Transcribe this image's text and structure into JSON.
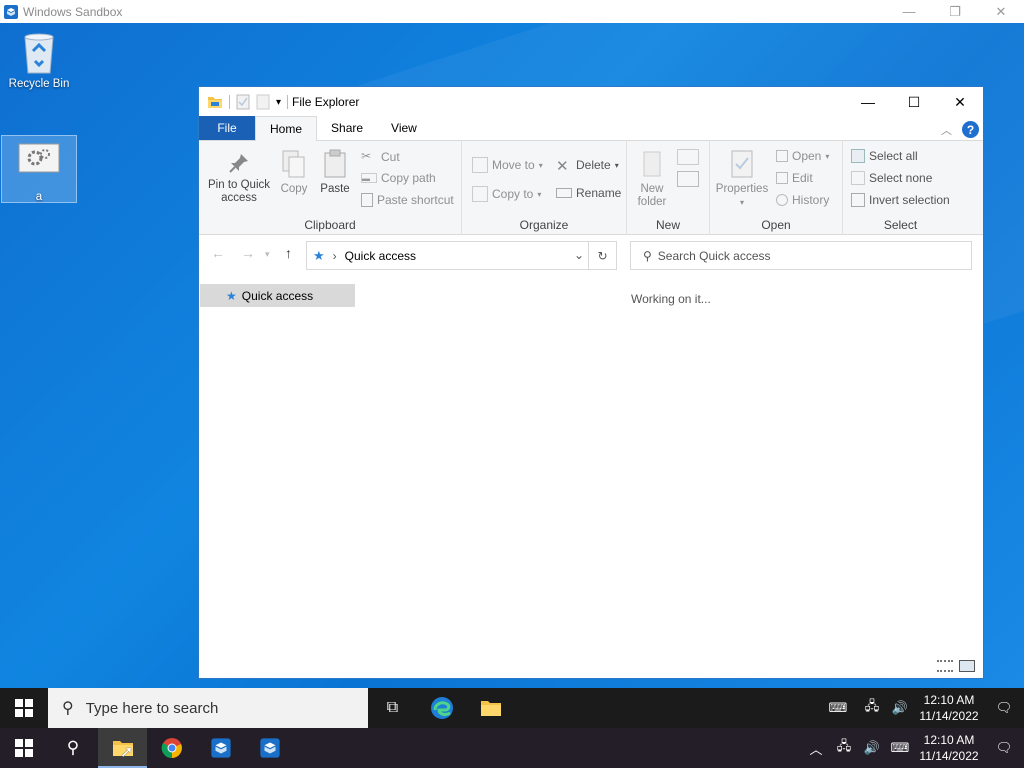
{
  "host": {
    "title": "Windows Sandbox",
    "min": "—",
    "max": "❐",
    "close": "✕"
  },
  "desktop": {
    "icons": [
      {
        "label": "Recycle Bin"
      },
      {
        "label": "a"
      }
    ]
  },
  "explorer": {
    "title": "File Explorer",
    "controls": {
      "min": "—",
      "max": "☐",
      "close": "✕"
    },
    "tabs": [
      "File",
      "Home",
      "Share",
      "View"
    ],
    "ribbon": {
      "clipboard": {
        "label": "Clipboard",
        "pin": "Pin to Quick access",
        "copy": "Copy",
        "paste": "Paste",
        "cut": "Cut",
        "copy_path": "Copy path",
        "paste_shortcut": "Paste shortcut"
      },
      "organize": {
        "label": "Organize",
        "move_to": "Move to",
        "copy_to": "Copy to",
        "delete": "Delete",
        "rename": "Rename"
      },
      "new": {
        "label": "New",
        "new_folder": "New folder"
      },
      "open": {
        "label": "Open",
        "properties": "Properties",
        "open": "Open",
        "edit": "Edit",
        "history": "History"
      },
      "select": {
        "label": "Select",
        "select_all": "Select all",
        "select_none": "Select none",
        "invert": "Invert selection"
      }
    },
    "address": {
      "location": "Quick access"
    },
    "search": {
      "placeholder": "Search Quick access"
    },
    "nav_pane": {
      "item": "Quick access"
    },
    "status": {
      "message": "Working on it..."
    }
  },
  "taskbar1": {
    "search_placeholder": "Type here to search",
    "time": "12:10 AM",
    "date": "11/14/2022"
  },
  "taskbar2": {
    "time": "12:10 AM",
    "date": "11/14/2022"
  },
  "colors": {
    "accent": "#1a61b5",
    "desktop": "#0f6fd1",
    "taskbar": "#1b1b1b"
  }
}
